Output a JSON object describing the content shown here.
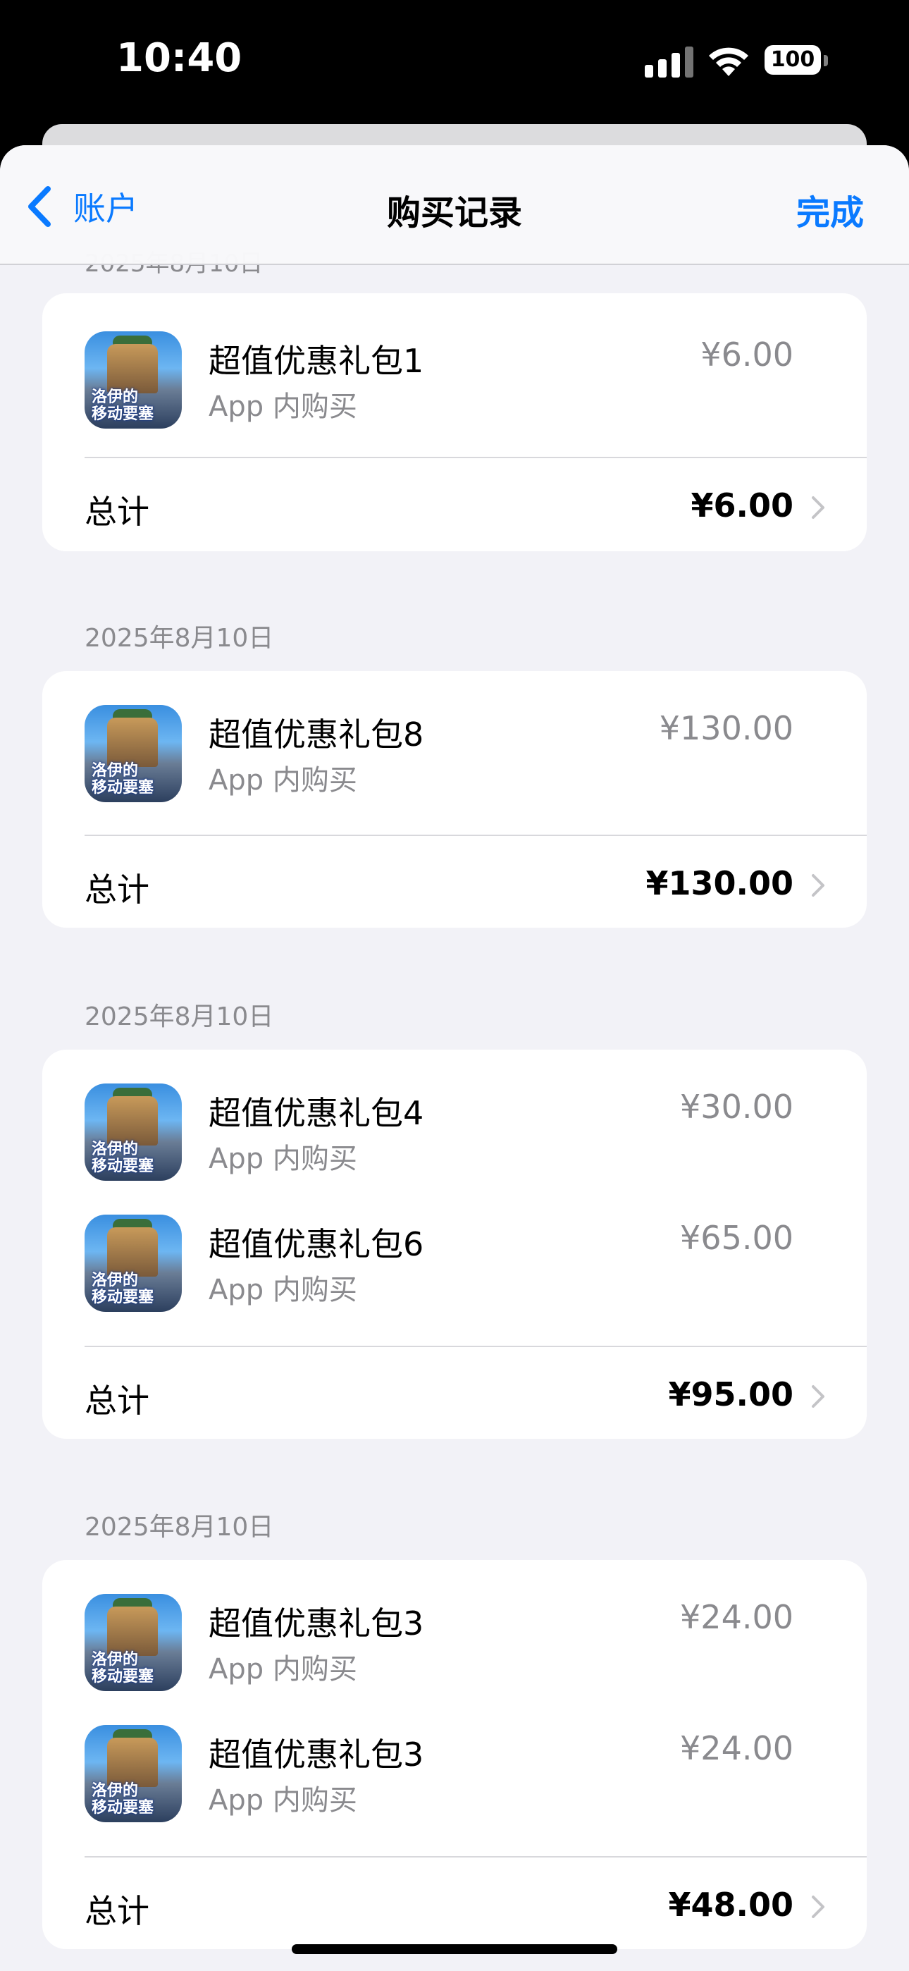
{
  "status_bar": {
    "time": "10:40",
    "battery": "100"
  },
  "nav": {
    "back_label": "账户",
    "title": "购买记录",
    "done_label": "完成"
  },
  "partial_date": "2025年8月10日",
  "app_icon_text": [
    "洛伊的",
    "移动要塞"
  ],
  "groups": [
    {
      "date": "",
      "items": [
        {
          "title": "超值优惠礼包1",
          "subtitle": "App 内购买",
          "price": "¥6.00"
        }
      ],
      "total_label": "总计",
      "total": "¥6.00"
    },
    {
      "date": "2025年8月10日",
      "items": [
        {
          "title": "超值优惠礼包8",
          "subtitle": "App 内购买",
          "price": "¥130.00"
        }
      ],
      "total_label": "总计",
      "total": "¥130.00"
    },
    {
      "date": "2025年8月10日",
      "items": [
        {
          "title": "超值优惠礼包4",
          "subtitle": "App 内购买",
          "price": "¥30.00"
        },
        {
          "title": "超值优惠礼包6",
          "subtitle": "App 内购买",
          "price": "¥65.00"
        }
      ],
      "total_label": "总计",
      "total": "¥95.00"
    },
    {
      "date": "2025年8月10日",
      "items": [
        {
          "title": "超值优惠礼包3",
          "subtitle": "App 内购买",
          "price": "¥24.00"
        },
        {
          "title": "超值优惠礼包3",
          "subtitle": "App 内购买",
          "price": "¥24.00"
        }
      ],
      "total_label": "总计",
      "total": "¥48.00"
    }
  ],
  "colors": {
    "accent": "#0a7aff",
    "secondary_text": "#8a8a8e",
    "background": "#f2f2f7"
  }
}
